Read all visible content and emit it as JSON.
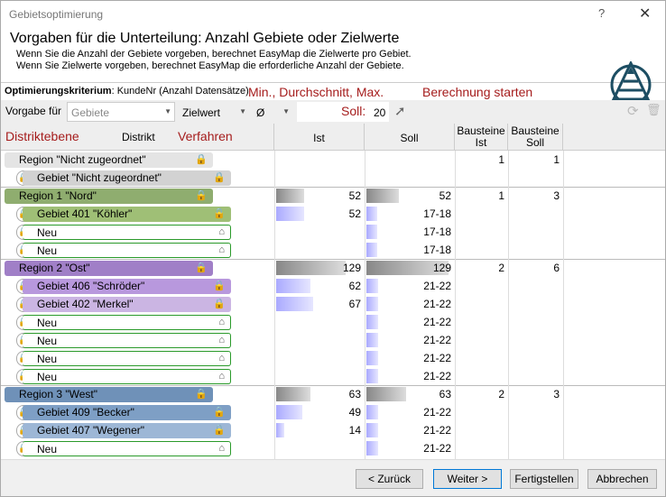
{
  "window": {
    "title": "Gebietsoptimierung",
    "help": "?",
    "close": "✕"
  },
  "header": {
    "title": "Vorgaben für die Unterteilung: Anzahl Gebiete oder Zielwerte",
    "line1": "Wenn Sie die Anzahl der Gebiete vorgeben, berechnet EasyMap die Zielwerte pro Gebiet.",
    "line2": "Wenn Sie Zielwerte vorgeben, berechnet EasyMap die erforderliche Anzahl der Gebiete."
  },
  "criterion": {
    "label": "Optimierungskriterium",
    "value": ": KundeNr (Anzahl Datensätze)"
  },
  "annotations": {
    "minmax": "Min., Durchschnitt, Max.",
    "start": "Berechnung starten",
    "soll": "Soll:",
    "distrikt": "Distriktebene",
    "verfahren": "Verfahren"
  },
  "toolbar": {
    "vorgabe_label": "Vorgabe für",
    "vorgabe_value": "Gebiete",
    "verfahren_value": "Zielwert",
    "avg_value": "Ø",
    "soll_value": "20",
    "go": "➚",
    "refresh": "⟳",
    "delete": "🗑"
  },
  "columns": {
    "distrikt": "Distrikt",
    "ist": "Ist",
    "soll": "Soll",
    "bist": "Bausteine Ist",
    "bsoll": "Bausteine Soll"
  },
  "colors": {
    "accent": "#a51c1c",
    "bar": "#c9c9ff",
    "regionbar": "#b0b0b0"
  },
  "rows": [
    {
      "kind": "region",
      "label": "Region  \"Nicht zugeordnet\"",
      "color": "#e4e4e4",
      "ist": "",
      "soll": "",
      "bist": "1",
      "bsoll": "1",
      "istf": 0,
      "sollf": 0
    },
    {
      "kind": "gebiet",
      "label": "Gebiet  \"Nicht zugeordnet\"",
      "color": "#d2d2d2",
      "ist": "",
      "soll": "",
      "istf": 0,
      "sollf": 0
    },
    {
      "kind": "region",
      "label": "Region 1 \"Nord\"",
      "color": "#8fad6f",
      "ist": "52",
      "soll": "52",
      "bist": "1",
      "bsoll": "3",
      "istf": 0.32,
      "sollf": 0.38
    },
    {
      "kind": "gebiet",
      "label": "Gebiet 401 \"Köhler\"",
      "color": "#9fbf76",
      "ist": "52",
      "soll": "17-18",
      "istf": 0.32,
      "sollf": 0.12
    },
    {
      "kind": "neu",
      "label": "Neu",
      "ist": "",
      "soll": "17-18",
      "istf": 0,
      "sollf": 0.12
    },
    {
      "kind": "neu",
      "label": "Neu",
      "ist": "",
      "soll": "17-18",
      "istf": 0,
      "sollf": 0.12
    },
    {
      "kind": "region",
      "label": "Region 2 \"Ost\"",
      "color": "#a07fc7",
      "ist": "129",
      "soll": "129",
      "bist": "2",
      "bsoll": "6",
      "istf": 0.8,
      "sollf": 0.95
    },
    {
      "kind": "gebiet",
      "label": "Gebiet 406 \"Schröder\"",
      "color": "#b898dd",
      "ist": "62",
      "soll": "21-22",
      "istf": 0.4,
      "sollf": 0.14
    },
    {
      "kind": "gebiet",
      "label": "Gebiet 402 \"Merkel\"",
      "color": "#cbb5e3",
      "ist": "67",
      "soll": "21-22",
      "istf": 0.43,
      "sollf": 0.14
    },
    {
      "kind": "neu",
      "label": "Neu",
      "ist": "",
      "soll": "21-22",
      "istf": 0,
      "sollf": 0.14
    },
    {
      "kind": "neu",
      "label": "Neu",
      "ist": "",
      "soll": "21-22",
      "istf": 0,
      "sollf": 0.14
    },
    {
      "kind": "neu",
      "label": "Neu",
      "ist": "",
      "soll": "21-22",
      "istf": 0,
      "sollf": 0.14
    },
    {
      "kind": "neu",
      "label": "Neu",
      "ist": "",
      "soll": "21-22",
      "istf": 0,
      "sollf": 0.14
    },
    {
      "kind": "region",
      "label": "Region 3 \"West\"",
      "color": "#6f91b8",
      "ist": "63",
      "soll": "63",
      "bist": "2",
      "bsoll": "3",
      "istf": 0.4,
      "sollf": 0.46
    },
    {
      "kind": "gebiet",
      "label": "Gebiet 409 \"Becker\"",
      "color": "#7e9fc5",
      "ist": "49",
      "soll": "21-22",
      "istf": 0.3,
      "sollf": 0.14
    },
    {
      "kind": "gebiet",
      "label": "Gebiet 407 \"Wegener\"",
      "color": "#9db7d6",
      "ist": "14",
      "soll": "21-22",
      "istf": 0.09,
      "sollf": 0.14
    },
    {
      "kind": "neu",
      "label": "Neu",
      "ist": "",
      "soll": "21-22",
      "istf": 0,
      "sollf": 0.14
    }
  ],
  "footer": {
    "back": "< Zurück",
    "next": "Weiter >",
    "finish": "Fertigstellen",
    "cancel": "Abbrechen"
  }
}
